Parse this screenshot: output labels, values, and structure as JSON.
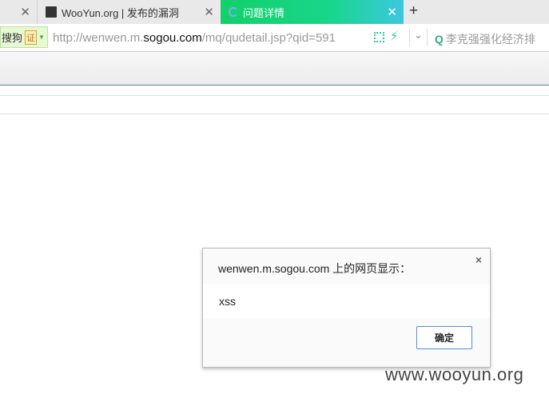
{
  "tabs": [
    {
      "label": "",
      "close": "✕"
    },
    {
      "label": "WooYun.org | 发布的漏洞",
      "close": "✕"
    },
    {
      "label": "问题详情",
      "close": "✕",
      "active": true
    }
  ],
  "new_tab": "+",
  "address": {
    "engine_label": "搜狗",
    "cert_label": "证",
    "url_prefix": "http://wenwen.m.",
    "url_domain": "sogou.com",
    "url_suffix": "/mq/qudetail.jsp?qid=591",
    "search_placeholder": "李克强强化经济排"
  },
  "dialog": {
    "title": "wenwen.m.sogou.com 上的网页显示：",
    "message": "xss",
    "ok_label": "确定",
    "close": "×"
  },
  "watermark": "www.wooyun.org",
  "colors": {
    "active_tab": "#12d06a",
    "ok_border": "#4a90e2"
  }
}
